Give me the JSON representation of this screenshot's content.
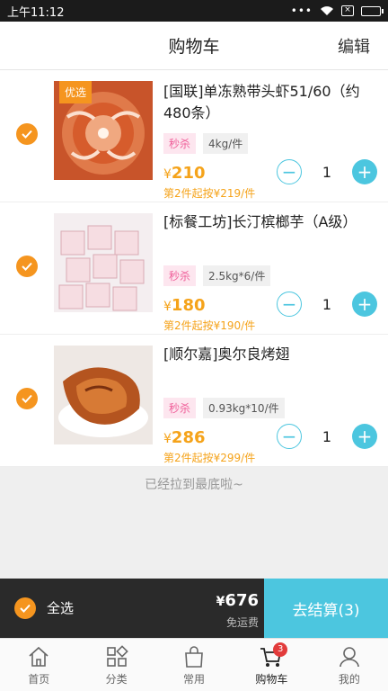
{
  "status": {
    "time": "上午11:12",
    "dots": "•••"
  },
  "header": {
    "title": "购物车",
    "edit": "编辑"
  },
  "items": [
    {
      "tag": "优选",
      "name": "[国联]单冻熟带头虾51/60（约480条）",
      "sale": "秒杀",
      "spec": "4kg/件",
      "price": "210",
      "second": "第2件起按¥219/件",
      "qty": "1",
      "image": "cooked-shrimp-photo"
    },
    {
      "tag": "",
      "name": "[标餐工坊]长汀槟榔芋（A级）",
      "sale": "秒杀",
      "spec": "2.5kg*6/件",
      "price": "180",
      "second": "第2件起按¥190/件",
      "qty": "1",
      "image": "taro-cubes-photo"
    },
    {
      "tag": "",
      "name": "[顺尔嘉]奥尔良烤翅",
      "sale": "秒杀",
      "spec": "0.93kg*10/件",
      "price": "286",
      "second": "第2件起按¥299/件",
      "qty": "1",
      "image": "roasted-wings-photo"
    }
  ],
  "currency": "¥",
  "end_text": "已经拉到最底啦~",
  "checkout": {
    "select_all": "全选",
    "total": "676",
    "free_shipping": "免运费",
    "go": "去结算(3)"
  },
  "tabs": [
    {
      "label": "首页",
      "icon": "home-icon"
    },
    {
      "label": "分类",
      "icon": "category-icon"
    },
    {
      "label": "常用",
      "icon": "bag-icon"
    },
    {
      "label": "购物车",
      "icon": "cart-icon",
      "badge": "3"
    },
    {
      "label": "我的",
      "icon": "profile-icon"
    }
  ],
  "colors": {
    "accent": "#4cc6df",
    "orange": "#f5951f",
    "price": "#f5a31a",
    "sale_bg": "#fde6ef",
    "sale_text": "#f0609a"
  }
}
